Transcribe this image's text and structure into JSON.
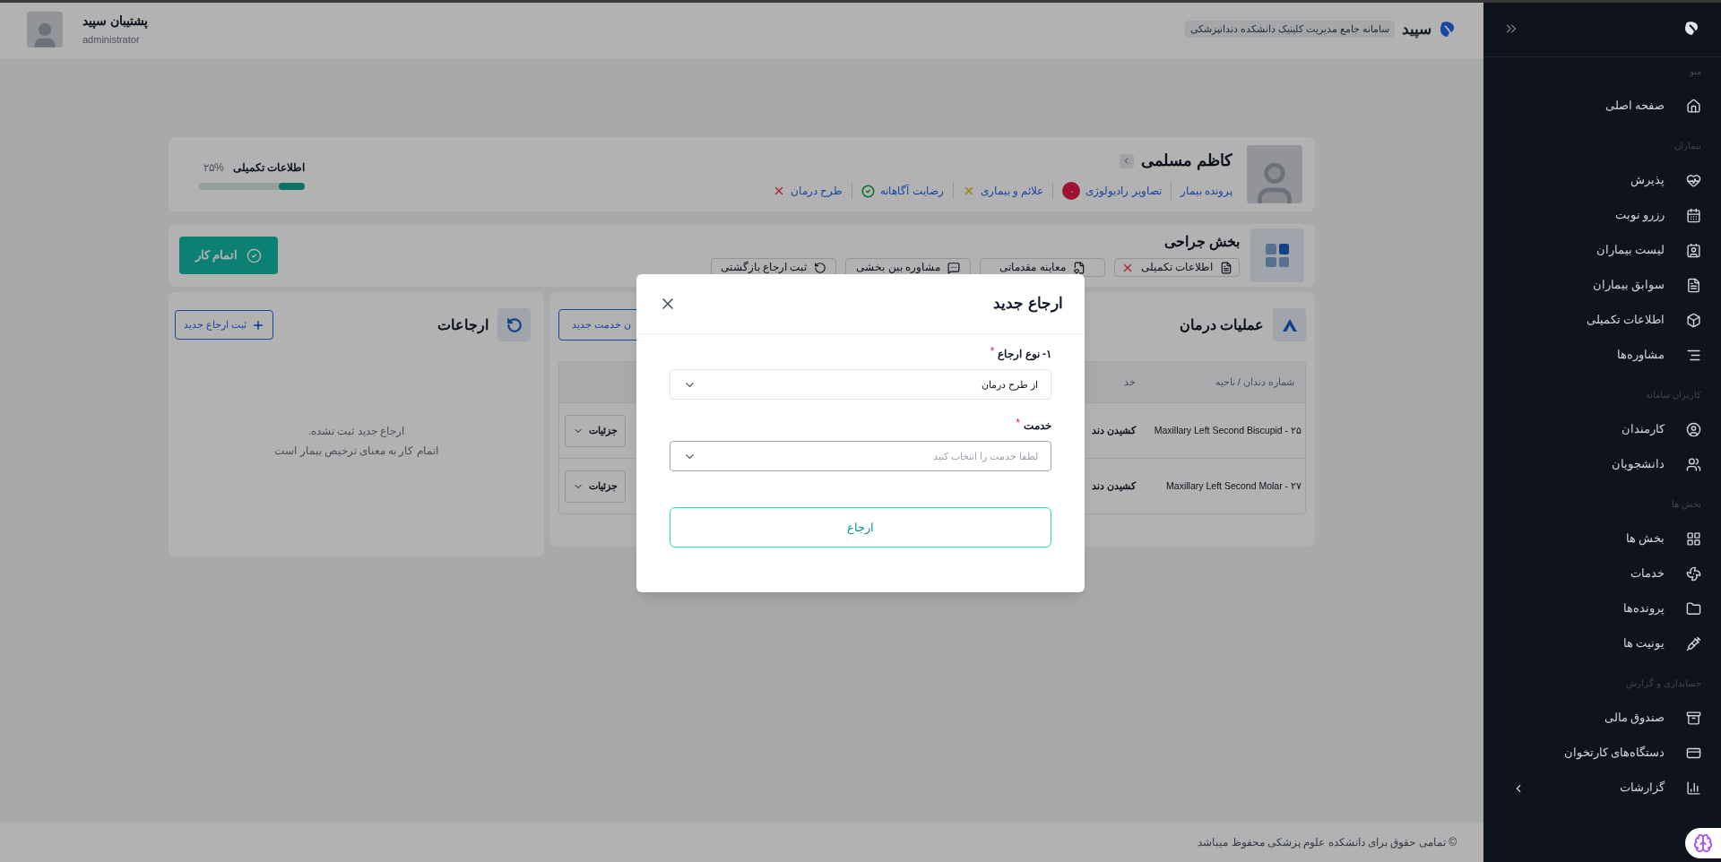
{
  "header": {
    "brand": "سپید",
    "subtitle": "سامانه جامع مدیریت کلینیک دانشکده دندانپزشکی",
    "user_name": "پشتیبان سپید",
    "user_role": "administrator"
  },
  "sidebar": {
    "sections": [
      {
        "title": "منو",
        "items": [
          {
            "label": "صفحه اصلی",
            "kind": "link"
          }
        ]
      },
      {
        "title": "بیماران",
        "items": [
          {
            "label": "پذیرش",
            "kind": "link"
          },
          {
            "label": "رزرو نوبت",
            "kind": "link"
          },
          {
            "label": "لیست بیماران",
            "kind": "link"
          },
          {
            "label": "سوابق بیماران",
            "kind": "link"
          },
          {
            "label": "اطلاعات تکمیلی",
            "kind": "link"
          },
          {
            "label": "مشاوره‌ها",
            "kind": "link"
          }
        ]
      },
      {
        "title": "کاربران سامانه",
        "items": [
          {
            "label": "کارمندان",
            "kind": "link"
          },
          {
            "label": "دانشجویان",
            "kind": "link"
          }
        ]
      },
      {
        "title": "بخش ها",
        "items": [
          {
            "label": "بخش ها",
            "kind": "link"
          },
          {
            "label": "خدمات",
            "kind": "link"
          },
          {
            "label": "پرونده‌ها",
            "kind": "link"
          },
          {
            "label": "یونیت ها",
            "kind": "link"
          }
        ]
      },
      {
        "title": "حسابداری و گزارش",
        "items": [
          {
            "label": "صندوق مالی",
            "kind": "link"
          },
          {
            "label": "دستگاه‌های کارتخوان",
            "kind": "link"
          },
          {
            "label": "گزارشات",
            "kind": "group"
          }
        ]
      }
    ]
  },
  "patient": {
    "name": "کاظم مسلمی",
    "links": [
      {
        "label": "پرونده بیمار",
        "kind": "link"
      },
      {
        "label": "تصاویر رادیولوژی",
        "kind": "count",
        "count": "۰"
      },
      {
        "label": "علائم و بیماری",
        "kind": "status",
        "checked": false,
        "color": "#a47d06"
      },
      {
        "label": "رضایت آگاهانه",
        "kind": "status",
        "checked": true,
        "color": "#0f7234"
      },
      {
        "label": "طرح درمان",
        "kind": "status",
        "checked": false,
        "color": "#a03236"
      }
    ],
    "progress": {
      "label": "اطلاعات تکمیلی",
      "reading": "۲۵%",
      "level": 0.25
    }
  },
  "department": {
    "title": "بخش جراحی",
    "finish_button": "اتمام کار",
    "actions": [
      {
        "label": "اطلاعات تکمیلی",
        "kind": "status",
        "checked": false,
        "color": "#a03236"
      },
      {
        "label": "معاینه مقدماتی",
        "kind": "plain"
      },
      {
        "label": "مشاوره بین بخشی",
        "kind": "plain"
      },
      {
        "label": "ثبت ارجاع بازگشتی",
        "kind": "plain"
      }
    ]
  },
  "operations": {
    "title": "عملیات درمان",
    "add_button": "ن خدمت جدید",
    "columns": [
      "شماره دندان / ناحیه",
      "خد"
    ],
    "rows": [
      {
        "tooth": "Maxillary Left Second Biscupid - ۲۵",
        "service": "کشیدن دند",
        "details": "جزئیات"
      },
      {
        "tooth": "Maxillary Left Second Molar - ۲۷",
        "service": "کشیدن دند",
        "details": "جزئیات"
      }
    ]
  },
  "referrals": {
    "title": "ارجاعات",
    "add_button": "ثبت ارجاع جدید",
    "empty_lines": [
      "ارجاع جدید ثبت نشده.",
      "اتمام کار به معنای ترخیص بیمار است"
    ]
  },
  "footer": "© تمامی حقوق برای دانشکده علوم پزشکی محفوظ میباشد",
  "modal": {
    "title": "ارجاع جدید",
    "fields": [
      {
        "label": "۱- نوع ارجاع",
        "required_mark": "*",
        "value": "از طرح درمان"
      },
      {
        "label": "خدمت",
        "required_mark": "*",
        "placeholder": "لطفا خدمت را انتخاب کنید"
      }
    ],
    "submit": "ارجاع"
  }
}
